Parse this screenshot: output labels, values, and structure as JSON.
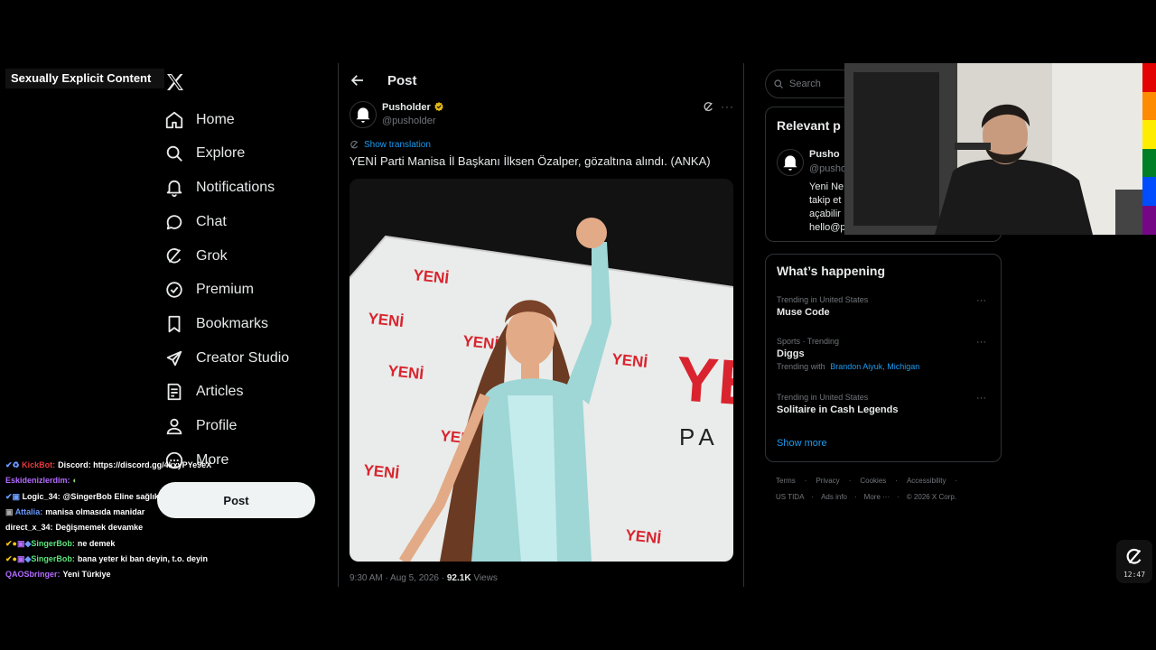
{
  "overlay_label": "Sexually Explicit Content",
  "nav": [
    {
      "label": "Home",
      "icon": "home-icon"
    },
    {
      "label": "Explore",
      "icon": "search-icon"
    },
    {
      "label": "Notifications",
      "icon": "bell-icon"
    },
    {
      "label": "Chat",
      "icon": "chat-icon"
    },
    {
      "label": "Grok",
      "icon": "grok-icon"
    },
    {
      "label": "Premium",
      "icon": "premium-icon"
    },
    {
      "label": "Bookmarks",
      "icon": "bookmark-icon"
    },
    {
      "label": "Creator Studio",
      "icon": "rocket-icon"
    },
    {
      "label": "Articles",
      "icon": "articles-icon"
    },
    {
      "label": "Profile",
      "icon": "person-icon"
    },
    {
      "label": "More",
      "icon": "more-circle-icon"
    }
  ],
  "post_button": "Post",
  "chat": [
    {
      "user": "KickBot:",
      "msg": "Discord: https://discord.gg/4kxyPYe9eX",
      "color": "#e8373c"
    },
    {
      "user": "Eskidenizlerdim:",
      "msg": "",
      "color": "#b36bff"
    },
    {
      "user": "Logic_34:",
      "msg": "@SingerBob Eline sağlık",
      "color": "#ffffff"
    },
    {
      "user": "Attalia:",
      "msg": "manisa olmasıda manidar",
      "color": "#6b9bff"
    },
    {
      "user": "direct_x_34:",
      "msg": "Değişmemek devamke",
      "color": "#ffffff"
    },
    {
      "user": "SingerBob:",
      "msg": "ne demek",
      "color": "#5be37a"
    },
    {
      "user": "SingerBob:",
      "msg": "bana yeter ki ban deyin, t.o. deyin",
      "color": "#5be37a"
    },
    {
      "user": "QAOSbringer:",
      "msg": "Yeni Türkiye",
      "color": "#b36bff"
    }
  ],
  "main": {
    "title": "Post",
    "author_name": "Pusholder",
    "author_handle": "@pusholder",
    "show_translation": "Show translation",
    "text": "YENİ Parti Manisa İl Başkanı İlksen Özalper, gözaltına alındı. (ANKA)",
    "meta_time": "9:30 AM · Aug 5, 2026 · ",
    "meta_views": "92.1K",
    "meta_views_label": " Views",
    "image_banner_text": "YENİ",
    "image_big_text": "YE",
    "image_pa_text": "PA"
  },
  "right": {
    "search_placeholder": "Search",
    "relevant_title": "Relevant p",
    "relevant_name": "Pusho",
    "relevant_handle": "@pusho",
    "relevant_bio": [
      "Yeni Ne",
      "takip et",
      "açabilir",
      "hello@p"
    ],
    "happening_title": "What’s happening",
    "trends": [
      {
        "context": "Trending in United States",
        "title": "Muse Code",
        "with_label": "",
        "with_links": ""
      },
      {
        "context": "Sports · Trending",
        "title": "Diggs",
        "with_label": "Trending with",
        "with_links": "Brandon Aiyuk, Michigan"
      },
      {
        "context": "Trending in United States",
        "title": "Solitaire in Cash Legends",
        "with_label": "",
        "with_links": ""
      }
    ],
    "show_more": "Show more",
    "footer_row1": [
      "Terms",
      "Privacy",
      "Cookies",
      "Accessibility"
    ],
    "footer_row2": [
      "US TIDA",
      "Ads info",
      "More ···",
      "© 2026 X Corp."
    ]
  },
  "watermark_time": "12:47",
  "colors": {
    "bg": "#000000",
    "link": "#1d9bf0",
    "text": "#e7e9ea",
    "muted": "#71767b",
    "border": "#2f3336"
  }
}
